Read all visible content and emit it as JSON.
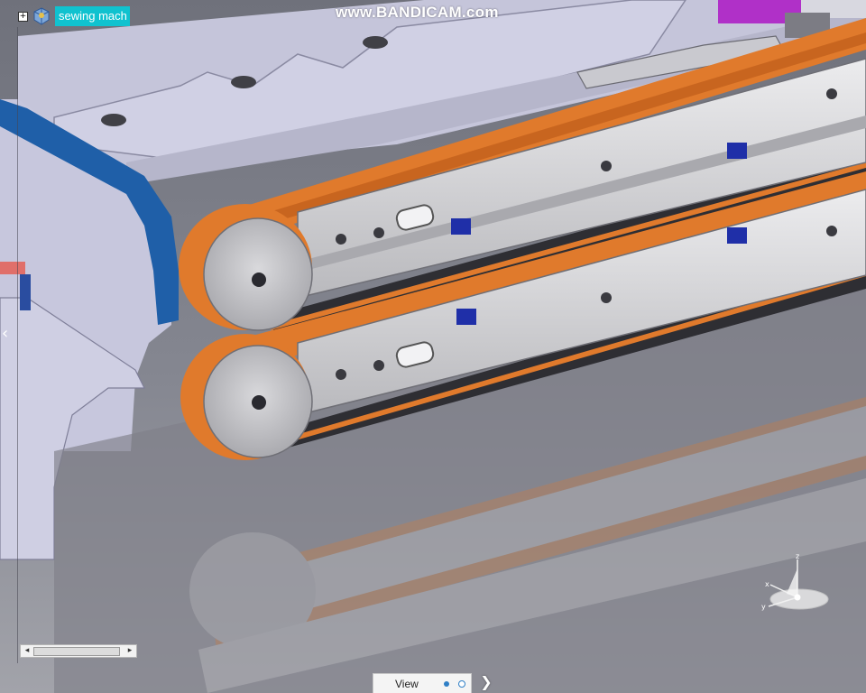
{
  "spec_tree": {
    "root_label": "sewing mach",
    "expand_symbol": "+",
    "root_icon": "product-icon"
  },
  "watermark": {
    "text": "www.BANDICAM.com"
  },
  "side_panel": {
    "collapse_glyph": "‹"
  },
  "scrollbar": {
    "left_glyph": "◂",
    "right_glyph": "▸"
  },
  "view_toolbar": {
    "label": "View",
    "expand_glyph": "❯",
    "page_dots": 2,
    "active_page": 1
  },
  "compass": {
    "axis_labels": [
      "z",
      "x",
      "y"
    ]
  },
  "colors": {
    "belt_orange": "#e07a2c",
    "rail_gray": "#d7d7d9",
    "frame_lavender": "#c9c9df",
    "guard_blue": "#1f5fa8",
    "block_magenta": "#b030c8",
    "tree_highlight": "#10c2cf"
  }
}
